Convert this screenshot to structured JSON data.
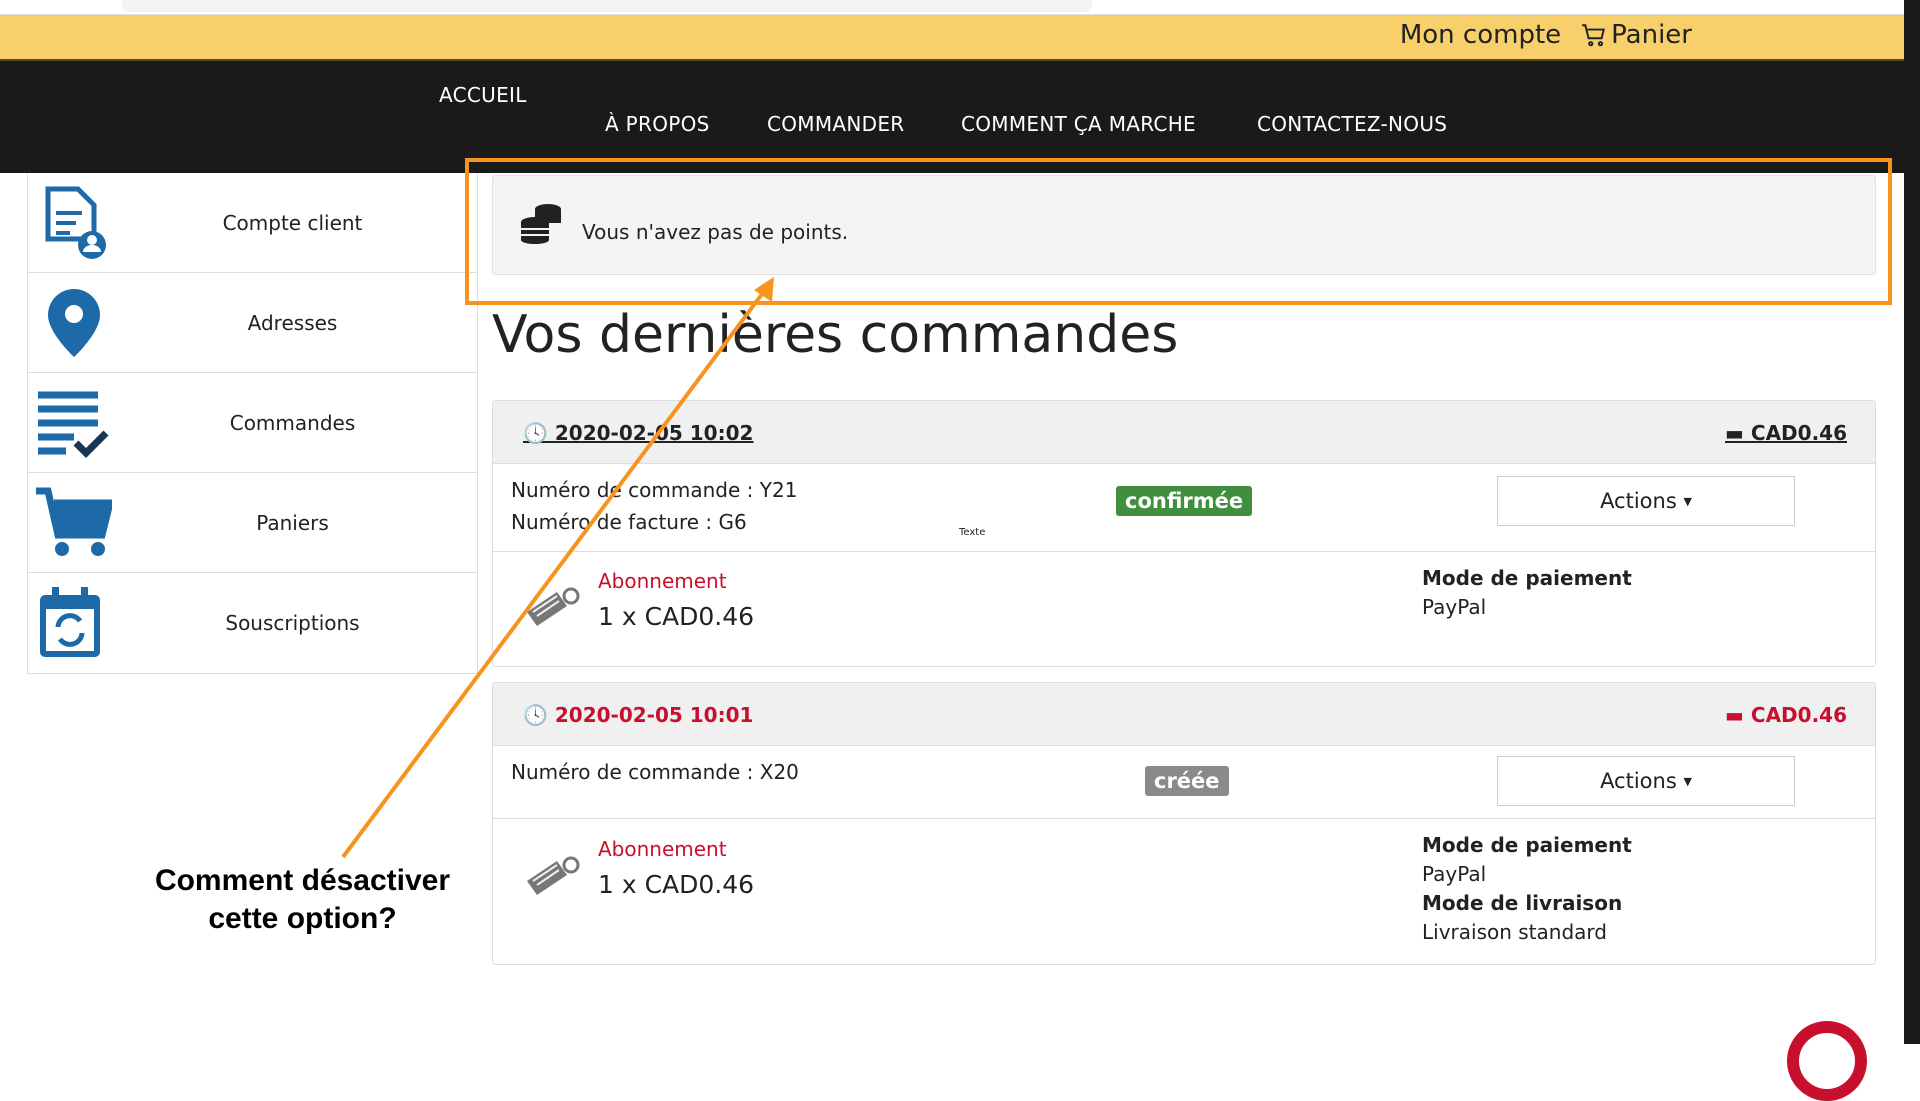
{
  "topbar": {
    "account": "Mon compte",
    "cart": "Panier"
  },
  "nav": [
    "ACCUEIL",
    "À PROPOS",
    "COMMANDER",
    "COMMENT ÇA MARCHE",
    "CONTACTEZ-NOUS"
  ],
  "sidebar": [
    {
      "label": "Compte client",
      "icon": "document-user-icon"
    },
    {
      "label": "Adresses",
      "icon": "map-pin-icon"
    },
    {
      "label": "Commandes",
      "icon": "list-check-icon"
    },
    {
      "label": "Paniers",
      "icon": "cart-icon"
    },
    {
      "label": "Souscriptions",
      "icon": "calendar-refresh-icon"
    }
  ],
  "points": {
    "text": "Vous n'avez pas de points."
  },
  "heading": "Vos dernières commandes",
  "orders": [
    {
      "date": "2020-02-05 10:02",
      "total": "CAD0.46",
      "order_no": "Numéro de commande : Y21",
      "invoice_no": "Numéro de facture : G6",
      "status": "confirmée",
      "actions": "Actions",
      "item": "Abonnement",
      "qty": "1 x CAD0.46",
      "pay_label": "Mode de paiement",
      "pay": "PayPal",
      "note": "Texte"
    },
    {
      "date": "2020-02-05 10:01",
      "total": "CAD0.46",
      "order_no": "Numéro de commande : X20",
      "status": "créée",
      "actions": "Actions",
      "item": "Abonnement",
      "qty": "1 x CAD0.46",
      "pay_label": "Mode de paiement",
      "pay": "PayPal",
      "ship_label": "Mode de livraison",
      "ship": "Livraison standard"
    }
  ],
  "annotation": {
    "line1": "Comment désactiver",
    "line2": "cette option?"
  },
  "colors": {
    "accent": "#f8d06b",
    "nav": "#1a1a1a",
    "brand_blue": "#1e6aa8",
    "annotation": "#f7941d",
    "confirmed": "#3f8f3f",
    "created": "#8a8a8a",
    "red": "#c8102e"
  }
}
